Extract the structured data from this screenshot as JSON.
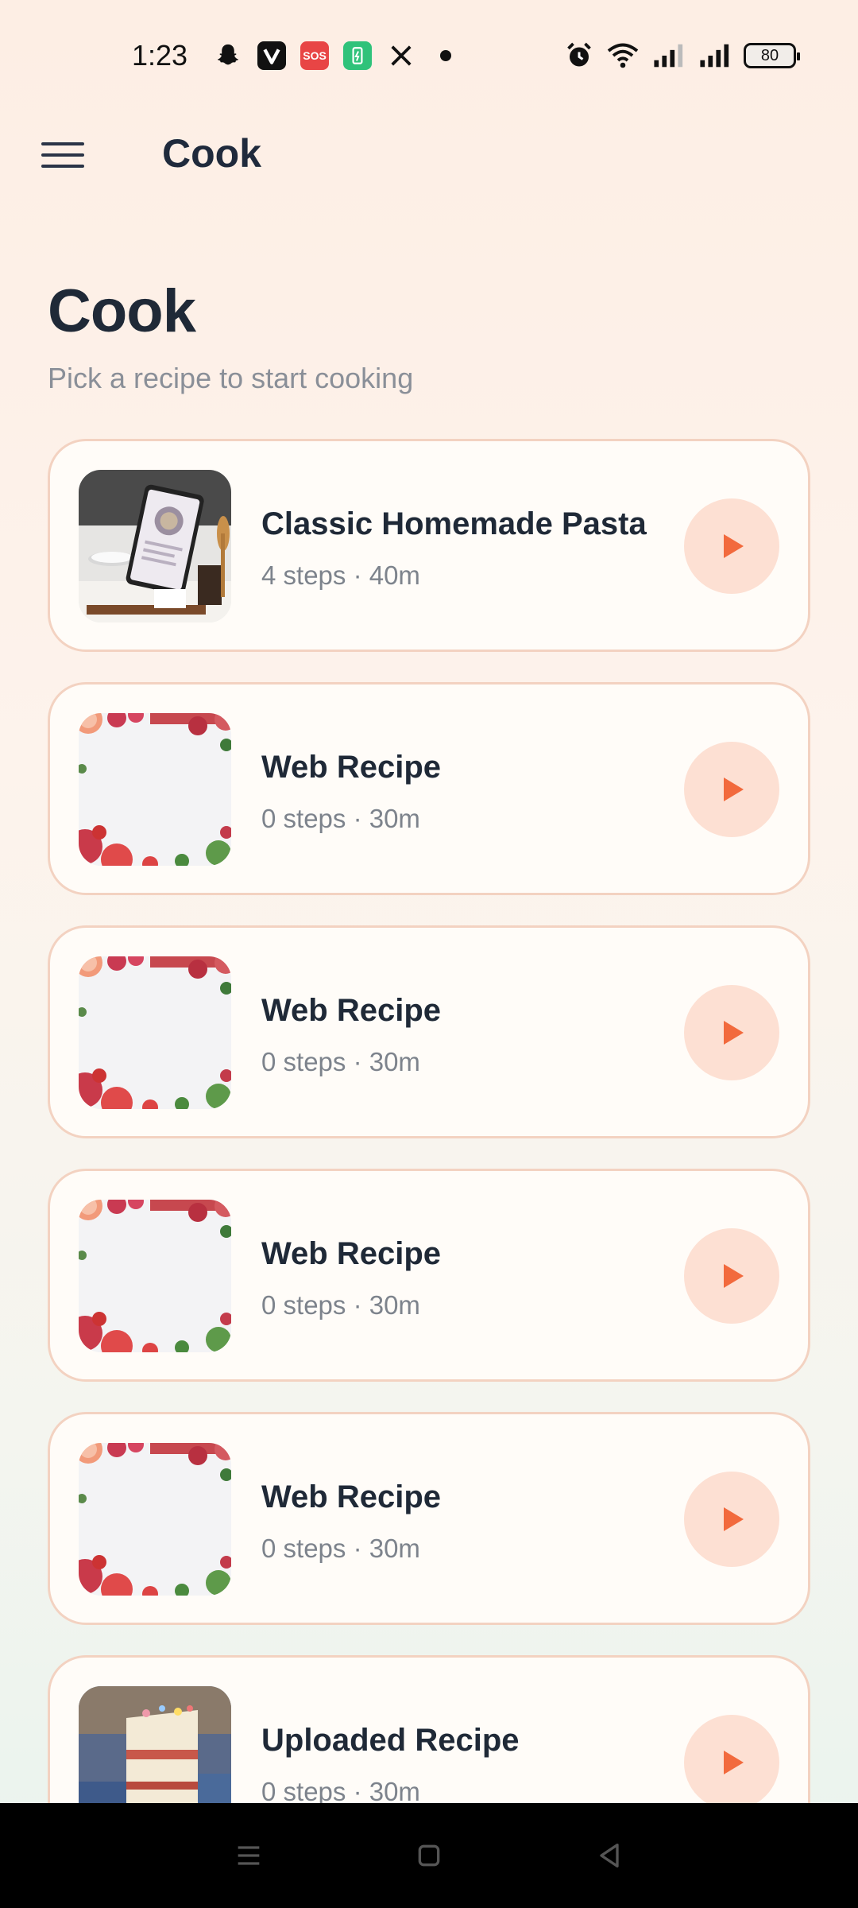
{
  "status_bar": {
    "time": "1:23",
    "battery_level": "80",
    "left_icons": [
      "snapchat-icon",
      "v-app-icon",
      "sos-icon",
      "battery-saver-icon",
      "x-icon",
      "dot-icon"
    ],
    "sos_label": "SOS",
    "right_icons": [
      "alarm-icon",
      "wifi-icon",
      "signal-icon",
      "signal-icon"
    ]
  },
  "app_bar": {
    "title": "Cook",
    "menu_icon": "hamburger-icon"
  },
  "page": {
    "title": "Cook",
    "subtitle": "Pick a recipe to start cooking"
  },
  "recipes": [
    {
      "name": "Classic Homemade Pasta",
      "meta": "4 steps · 40m",
      "thumb": "tablet-recipe-photo"
    },
    {
      "name": "Web Recipe",
      "meta": "0 steps · 30m",
      "thumb": "fruit-border-photo"
    },
    {
      "name": "Web Recipe",
      "meta": "0 steps · 30m",
      "thumb": "fruit-border-photo"
    },
    {
      "name": "Web Recipe",
      "meta": "0 steps · 30m",
      "thumb": "fruit-border-photo"
    },
    {
      "name": "Web Recipe",
      "meta": "0 steps · 30m",
      "thumb": "fruit-border-photo"
    },
    {
      "name": "Uploaded Recipe",
      "meta": "0 steps · 30m",
      "thumb": "cake-photo"
    }
  ],
  "colors": {
    "accent": "#f26a3d",
    "accent_soft": "#fde0d3",
    "card_border": "#f3d2c1",
    "title_text": "#1f2937",
    "muted_text": "#7d838c"
  },
  "nav_bar": {
    "icons": [
      "recents-icon",
      "home-icon",
      "back-icon"
    ]
  }
}
